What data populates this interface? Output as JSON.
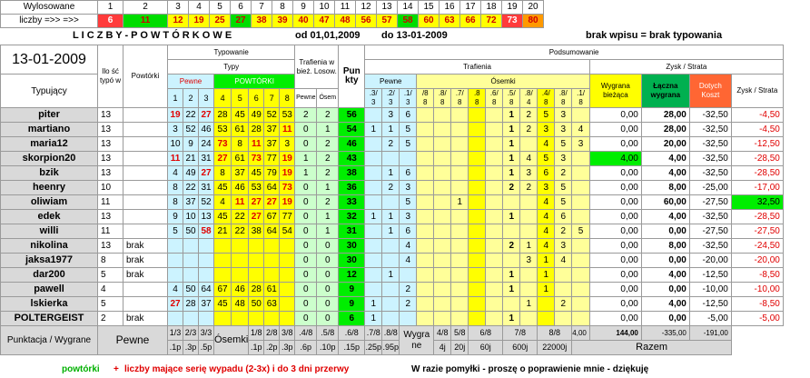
{
  "top": {
    "label1": "Wylosowane",
    "label2": "liczby =>> =>>",
    "positions": [
      "1",
      "2",
      "3",
      "4",
      "5",
      "6",
      "7",
      "8",
      "9",
      "10",
      "11",
      "12",
      "13",
      "14",
      "15",
      "16",
      "17",
      "18",
      "19",
      "20"
    ],
    "numbers": [
      "6",
      "11",
      "12",
      "19",
      "25",
      "27",
      "38",
      "39",
      "40",
      "47",
      "48",
      "56",
      "57",
      "58",
      "60",
      "63",
      "66",
      "72",
      "73",
      "80"
    ],
    "number_colors": [
      "red",
      "grn",
      "ylw",
      "ylw",
      "ylw",
      "grn",
      "ylw",
      "ylw",
      "ylw",
      "ylw",
      "ylw",
      "ylw",
      "ylw",
      "grn",
      "ylw",
      "ylw",
      "ylw",
      "ylw",
      "red",
      "org"
    ]
  },
  "line2": {
    "title": "L I C Z B Y   -   P O W T Ó R K O W E",
    "from": "od  01,01,2009",
    "to": "do  13-01-2009",
    "note": "brak wpisu = brak typowania"
  },
  "header": {
    "date": "13-01-2009",
    "typujacy": "Typujący",
    "ilosc": "Ilo ść typó w",
    "powtorki": "Powtórki",
    "typowanie": "Typowanie",
    "typy": "Typy",
    "pewne": "Pewne",
    "powtorki_upper": "POWTÓRKI",
    "trafienia_w_biez": "Trafienia w bież. Losow.",
    "pewne_s": "Pewne",
    "osem_s": "Ósem",
    "punkty": "Pun kty",
    "podsumowanie": "Podsumowanie",
    "trafienia": "Trafienia",
    "pewne2": "Pewne",
    "osemki": "Ósemki",
    "zysk_strata": "Zysk / Strata",
    "wygrana_biezaca": "Wygrana bieżąca",
    "laczna_wygrana": "Łączna wygrana",
    "dotych_koszt": "Dotych Koszt",
    "zysk_strata2": "Zysk / Strata",
    "type_cols": [
      "1",
      "2",
      "3",
      "4",
      "5",
      "6",
      "7",
      "8"
    ],
    "tr_top": [
      ".3/",
      ".2/",
      ".1/",
      "/8",
      ".8/",
      ".7/",
      ".8",
      ".6/",
      ".5/",
      ".8/",
      ".4/",
      ".8/",
      ".1/"
    ],
    "tr_bot": [
      "3",
      "3",
      "3",
      "8",
      "8",
      "8",
      "8",
      "8",
      "8",
      "4",
      "8",
      "8",
      "8"
    ]
  },
  "rows": [
    {
      "name": "piter",
      "ilosc": "13",
      "pow": "",
      "types": [
        "19",
        "22",
        "27",
        "28",
        "45",
        "49",
        "52",
        "53"
      ],
      "red": [
        0,
        2
      ],
      "pew": "2",
      "os": "2",
      "pts": "56",
      "tr": [
        "",
        "3",
        "6",
        "",
        "",
        "",
        "",
        "",
        "1",
        "2",
        "5",
        "3",
        ""
      ],
      "wb": "0,00",
      "lw": "28,00",
      "dk": "-32,50",
      "zs": "-4,50"
    },
    {
      "name": "martiano",
      "ilosc": "13",
      "pow": "",
      "types": [
        "3",
        "52",
        "46",
        "53",
        "61",
        "28",
        "37",
        "11"
      ],
      "red": [
        7
      ],
      "pew": "0",
      "os": "1",
      "pts": "54",
      "tr": [
        "1",
        "1",
        "5",
        "",
        "",
        "",
        "",
        "",
        "1",
        "2",
        "3",
        "3",
        "4"
      ],
      "wb": "0,00",
      "lw": "28,00",
      "dk": "-32,50",
      "zs": "-4,50"
    },
    {
      "name": "maria12",
      "ilosc": "13",
      "pow": "",
      "types": [
        "10",
        "9",
        "24",
        "73",
        "8",
        "11",
        "37",
        "3"
      ],
      "red": [
        3,
        5
      ],
      "pew": "0",
      "os": "2",
      "pts": "46",
      "tr": [
        "",
        "2",
        "5",
        "",
        "",
        "",
        "",
        "",
        "1",
        "",
        "4",
        "5",
        "3"
      ],
      "wb": "0,00",
      "lw": "20,00",
      "dk": "-32,50",
      "zs": "-12,50"
    },
    {
      "name": "skorpion20",
      "ilosc": "13",
      "pow": "",
      "types": [
        "11",
        "21",
        "31",
        "27",
        "61",
        "73",
        "77",
        "19"
      ],
      "red": [
        0,
        3,
        5,
        7
      ],
      "pew": "1",
      "os": "2",
      "pts": "43",
      "tr": [
        "",
        "",
        "",
        "",
        "",
        "",
        "",
        "",
        "1",
        "4",
        "5",
        "3",
        ""
      ],
      "wb": "4,00",
      "lw": "4,00",
      "dk": "-32,50",
      "zs": "-28,50"
    },
    {
      "name": "bzik",
      "ilosc": "13",
      "pow": "",
      "types": [
        "4",
        "49",
        "27",
        "8",
        "37",
        "45",
        "79",
        "19"
      ],
      "red": [
        2,
        7
      ],
      "pew": "1",
      "os": "2",
      "pts": "38",
      "tr": [
        "",
        "1",
        "6",
        "",
        "",
        "",
        "",
        "",
        "1",
        "3",
        "6",
        "2",
        ""
      ],
      "wb": "0,00",
      "lw": "4,00",
      "dk": "-32,50",
      "zs": "-28,50"
    },
    {
      "name": "heenry",
      "ilosc": "10",
      "pow": "",
      "types": [
        "8",
        "22",
        "31",
        "45",
        "46",
        "53",
        "64",
        "73"
      ],
      "red": [
        7
      ],
      "pew": "0",
      "os": "1",
      "pts": "36",
      "tr": [
        "",
        "2",
        "3",
        "",
        "",
        "",
        "",
        "",
        "2",
        "2",
        "3",
        "5",
        ""
      ],
      "wb": "0,00",
      "lw": "8,00",
      "dk": "-25,00",
      "zs": "-17,00"
    },
    {
      "name": "oliwiam",
      "ilosc": "11",
      "pow": "",
      "types": [
        "8",
        "37",
        "52",
        "4",
        "11",
        "27",
        "27",
        "19"
      ],
      "red": [
        4,
        5,
        6,
        7
      ],
      "pew": "0",
      "os": "2",
      "pts": "33",
      "tr": [
        "",
        "",
        "5",
        "",
        "",
        "1",
        "",
        "",
        "",
        "",
        "4",
        "5",
        ""
      ],
      "wb": "0,00",
      "lw": "60,00",
      "dk": "-27,50",
      "zs": "32,50"
    },
    {
      "name": "edek",
      "ilosc": "13",
      "pow": "",
      "types": [
        "9",
        "10",
        "13",
        "45",
        "22",
        "27",
        "67",
        "77"
      ],
      "red": [
        5
      ],
      "pew": "0",
      "os": "1",
      "pts": "32",
      "tr": [
        "1",
        "1",
        "3",
        "",
        "",
        "",
        "",
        "",
        "1",
        "",
        "4",
        "6",
        ""
      ],
      "wb": "0,00",
      "lw": "4,00",
      "dk": "-32,50",
      "zs": "-28,50"
    },
    {
      "name": "willi",
      "ilosc": "11",
      "pow": "",
      "types": [
        "5",
        "50",
        "58",
        "21",
        "22",
        "38",
        "64",
        "54"
      ],
      "red": [
        2
      ],
      "pew": "0",
      "os": "1",
      "pts": "31",
      "tr": [
        "",
        "1",
        "6",
        "",
        "",
        "",
        "",
        "",
        "",
        "",
        "4",
        "2",
        "5"
      ],
      "wb": "0,00",
      "lw": "0,00",
      "dk": "-27,50",
      "zs": "-27,50"
    },
    {
      "name": "nikolina",
      "ilosc": "13",
      "pow": "brak",
      "types": [
        "",
        "",
        "",
        "",
        "",
        "",
        "",
        ""
      ],
      "red": [],
      "pew": "0",
      "os": "0",
      "pts": "30",
      "tr": [
        "",
        "",
        "4",
        "",
        "",
        "",
        "",
        "",
        "2",
        "1",
        "4",
        "3",
        ""
      ],
      "wb": "0,00",
      "lw": "8,00",
      "dk": "-32,50",
      "zs": "-24,50"
    },
    {
      "name": "jaksa1977",
      "ilosc": "8",
      "pow": "brak",
      "types": [
        "",
        "",
        "",
        "",
        "",
        "",
        "",
        ""
      ],
      "red": [],
      "pew": "0",
      "os": "0",
      "pts": "30",
      "tr": [
        "",
        "",
        "4",
        "",
        "",
        "",
        "",
        "",
        "",
        "3",
        "1",
        "4",
        ""
      ],
      "wb": "0,00",
      "lw": "0,00",
      "dk": "-20,00",
      "zs": "-20,00"
    },
    {
      "name": "dar200",
      "ilosc": "5",
      "pow": "brak",
      "types": [
        "",
        "",
        "",
        "",
        "",
        "",
        "",
        ""
      ],
      "red": [],
      "pew": "0",
      "os": "0",
      "pts": "12",
      "tr": [
        "",
        "1",
        "",
        "",
        "",
        "",
        "",
        "",
        "1",
        "",
        "1",
        "",
        ""
      ],
      "wb": "0,00",
      "lw": "4,00",
      "dk": "-12,50",
      "zs": "-8,50"
    },
    {
      "name": "pawell",
      "ilosc": "4",
      "pow": "",
      "types": [
        "4",
        "50",
        "64",
        "67",
        "46",
        "28",
        "61",
        ""
      ],
      "red": [],
      "pew": "0",
      "os": "0",
      "pts": "9",
      "tr": [
        "",
        "",
        "2",
        "",
        "",
        "",
        "",
        "",
        "1",
        "",
        "1",
        "",
        ""
      ],
      "wb": "0,00",
      "lw": "0,00",
      "dk": "-10,00",
      "zs": "-10,00"
    },
    {
      "name": "lskierka",
      "ilosc": "5",
      "pow": "",
      "types": [
        "27",
        "28",
        "37",
        "45",
        "48",
        "50",
        "63",
        ""
      ],
      "red": [
        0
      ],
      "pew": "0",
      "os": "0",
      "pts": "9",
      "tr": [
        "1",
        "",
        "2",
        "",
        "",
        "",
        "",
        "",
        "",
        "1",
        "",
        "2",
        ""
      ],
      "wb": "0,00",
      "lw": "4,00",
      "dk": "-12,50",
      "zs": "-8,50"
    },
    {
      "name": "POLTERGEIST",
      "ilosc": "2",
      "pow": "brak",
      "types": [
        "",
        "",
        "",
        "",
        "",
        "",
        "",
        ""
      ],
      "red": [],
      "pew": "0",
      "os": "0",
      "pts": "6",
      "tr": [
        "1",
        "",
        "",
        "",
        "",
        "",
        "",
        "",
        "1",
        "",
        "",
        "",
        ""
      ],
      "wb": "0,00",
      "lw": "0,00",
      "dk": "-5,00",
      "zs": "-5,00"
    }
  ],
  "foot": {
    "punktacja": "Punktacja / Wygrane",
    "pewne": "Pewne",
    "p_top": [
      "1/3",
      "2/3",
      "3/3"
    ],
    "p_bot": [
      ".1p",
      ".3p",
      ".5p"
    ],
    "osemki": "Ósemki",
    "o_top": [
      "1/8",
      "2/8",
      "3/8"
    ],
    "o_bot": [
      ".1p",
      ".2p",
      ".3p"
    ],
    "t_top": [
      ".4/8",
      ".5/8"
    ],
    "t_bot": [
      ".6p",
      ".10p"
    ],
    "t2_top": [
      ".6/8",
      ".7/8",
      ".8/8"
    ],
    "t2_bot": [
      ".15p",
      ".25p",
      ".95p"
    ],
    "wygrane": "Wygra ne",
    "w_top": [
      "4/8",
      "5/8",
      "6/8",
      "7/8",
      "8/8"
    ],
    "w_bot": [
      "4j",
      "20j",
      "60j",
      "600j",
      "22000j"
    ],
    "sum_wb": "4,00",
    "sum_lw": "144,00",
    "sum_dk": "-335,00",
    "sum_zs": "-191,00",
    "razem": "Razem"
  },
  "footer": {
    "powtorki": "powtórki",
    "plus": "+",
    "desc": "liczby mające serię wypadu (2-3x) i do 3 dni przerwy",
    "note": "W razie pomyłki - proszę o poprawienie mnie - dziękuję"
  }
}
